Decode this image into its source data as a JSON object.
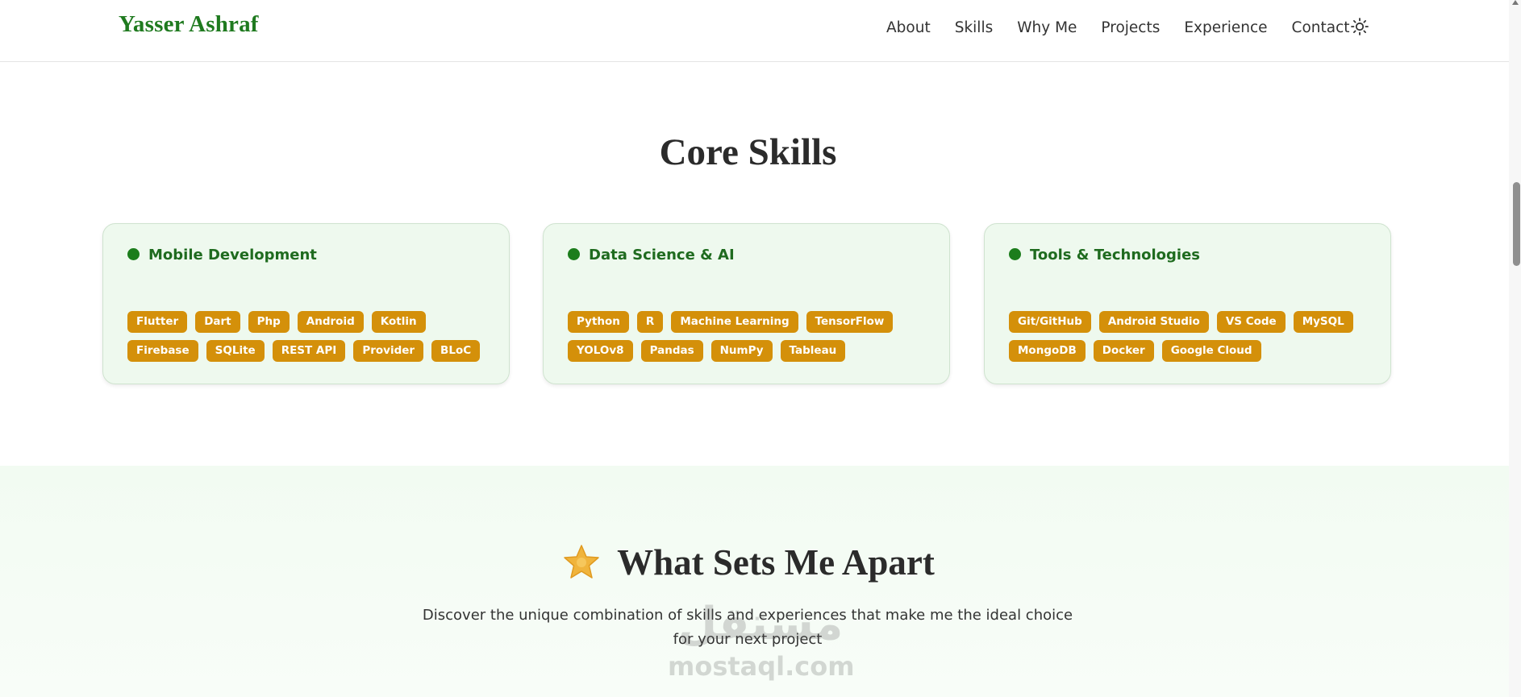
{
  "header": {
    "brand": "Yasser Ashraf",
    "nav": [
      "About",
      "Skills",
      "Why Me",
      "Projects",
      "Experience",
      "Contact"
    ],
    "theme_icon": "sun-icon"
  },
  "skills": {
    "title": "Core Skills",
    "cards": [
      {
        "title": "Mobile Development",
        "tags": [
          "Flutter",
          "Dart",
          "Php",
          "Android",
          "Kotlin",
          "Firebase",
          "SQLite",
          "REST API",
          "Provider",
          "BLoC"
        ]
      },
      {
        "title": "Data Science & AI",
        "tags": [
          "Python",
          "R",
          "Machine Learning",
          "TensorFlow",
          "YOLOv8",
          "Pandas",
          "NumPy",
          "Tableau"
        ]
      },
      {
        "title": "Tools & Technologies",
        "tags": [
          "Git/GitHub",
          "Android Studio",
          "VS Code",
          "MySQL",
          "MongoDB",
          "Docker",
          "Google Cloud"
        ]
      }
    ]
  },
  "apart": {
    "icon": "star-icon",
    "title": "What Sets Me Apart",
    "subtitle": "Discover the unique combination of skills and experiences that make me the ideal choice for your next project"
  },
  "watermark": {
    "arabic": "مستقل",
    "latin": "mostaql.com"
  },
  "colors": {
    "brand": "#1f7a1f",
    "tag": "#d4900a",
    "card_bg": "#eef9ee",
    "dot": "#1c7d1c"
  }
}
